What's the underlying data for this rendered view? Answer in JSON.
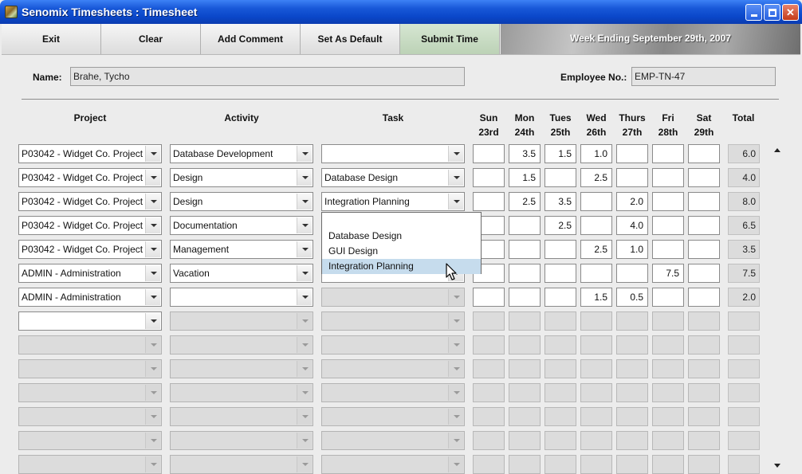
{
  "window": {
    "title": "Senomix Timesheets : Timesheet"
  },
  "toolbar": {
    "exit": "Exit",
    "clear": "Clear",
    "add_comment": "Add Comment",
    "set_default": "Set As Default",
    "submit": "Submit Time",
    "week_ending": "Week Ending September 29th, 2007"
  },
  "employee": {
    "name_label": "Name:",
    "name_value": "Brahe, Tycho",
    "number_label": "Employee No.:",
    "number_value": "EMP-TN-47"
  },
  "columns": {
    "project": "Project",
    "activity": "Activity",
    "task": "Task",
    "days": [
      {
        "day": "Sun",
        "date": "23rd"
      },
      {
        "day": "Mon",
        "date": "24th"
      },
      {
        "day": "Tues",
        "date": "25th"
      },
      {
        "day": "Wed",
        "date": "26th"
      },
      {
        "day": "Thurs",
        "date": "27th"
      },
      {
        "day": "Fri",
        "date": "28th"
      },
      {
        "day": "Sat",
        "date": "29th"
      }
    ],
    "total": "Total"
  },
  "rows": [
    {
      "project": "P03042 - Widget Co. Project",
      "activity": "Database Development",
      "task": "",
      "hours": [
        "",
        "3.5",
        "1.5",
        "1.0",
        "",
        "",
        ""
      ],
      "total": "6.0",
      "enabled": true
    },
    {
      "project": "P03042 - Widget Co. Project",
      "activity": "Design",
      "task": "Database Design",
      "hours": [
        "",
        "1.5",
        "",
        "2.5",
        "",
        "",
        ""
      ],
      "total": "4.0",
      "enabled": true
    },
    {
      "project": "P03042 - Widget Co. Project",
      "activity": "Design",
      "task": "Integration Planning",
      "hours": [
        "",
        "2.5",
        "3.5",
        "",
        "2.0",
        "",
        ""
      ],
      "total": "8.0",
      "enabled": true
    },
    {
      "project": "P03042 - Widget Co. Project",
      "activity": "Documentation",
      "task": "",
      "hours": [
        "",
        "",
        "2.5",
        "",
        "4.0",
        "",
        ""
      ],
      "total": "6.5",
      "enabled": true
    },
    {
      "project": "P03042 - Widget Co. Project",
      "activity": "Management",
      "task": "",
      "hours": [
        "",
        "",
        "",
        "2.5",
        "1.0",
        "",
        ""
      ],
      "total": "3.5",
      "enabled": true
    },
    {
      "project": "ADMIN - Administration",
      "activity": "Vacation",
      "task": "",
      "hours": [
        "",
        "",
        "",
        "",
        "",
        "7.5",
        ""
      ],
      "total": "7.5",
      "enabled": true
    },
    {
      "project": "ADMIN - Administration",
      "activity": "",
      "task": "",
      "hours": [
        "",
        "",
        "",
        "1.5",
        "0.5",
        "",
        ""
      ],
      "total": "2.0",
      "enabled": true,
      "task_disabled": true
    },
    {
      "project": "",
      "activity": "",
      "task": "",
      "hours": [
        "",
        "",
        "",
        "",
        "",
        "",
        ""
      ],
      "total": "",
      "enabled": false,
      "project_enabled": true
    },
    {
      "project": "",
      "activity": "",
      "task": "",
      "hours": [
        "",
        "",
        "",
        "",
        "",
        "",
        ""
      ],
      "total": "",
      "enabled": false
    },
    {
      "project": "",
      "activity": "",
      "task": "",
      "hours": [
        "",
        "",
        "",
        "",
        "",
        "",
        ""
      ],
      "total": "",
      "enabled": false
    },
    {
      "project": "",
      "activity": "",
      "task": "",
      "hours": [
        "",
        "",
        "",
        "",
        "",
        "",
        ""
      ],
      "total": "",
      "enabled": false
    },
    {
      "project": "",
      "activity": "",
      "task": "",
      "hours": [
        "",
        "",
        "",
        "",
        "",
        "",
        ""
      ],
      "total": "",
      "enabled": false
    },
    {
      "project": "",
      "activity": "",
      "task": "",
      "hours": [
        "",
        "",
        "",
        "",
        "",
        "",
        ""
      ],
      "total": "",
      "enabled": false
    },
    {
      "project": "",
      "activity": "",
      "task": "",
      "hours": [
        "",
        "",
        "",
        "",
        "",
        "",
        ""
      ],
      "total": "",
      "enabled": false
    }
  ],
  "task_dropdown": {
    "options": [
      "",
      "Database Design",
      "GUI Design",
      "Integration Planning"
    ],
    "highlighted": "Integration Planning"
  },
  "icons": {
    "app": "senomix-app-icon",
    "minimize": "minimize-icon",
    "maximize": "maximize-icon",
    "close": "close-icon",
    "cursor": "mouse-pointer-icon"
  }
}
